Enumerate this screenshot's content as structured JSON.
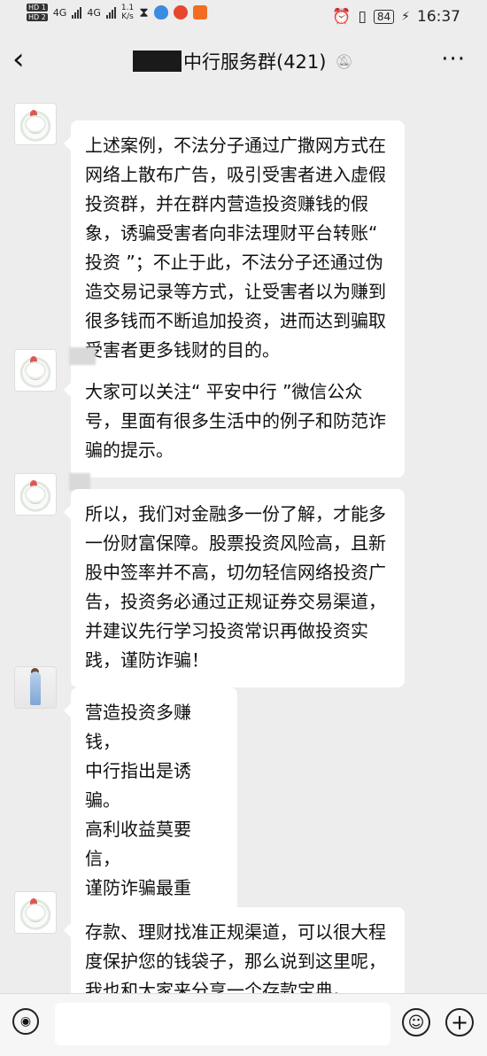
{
  "status_bar": {
    "hd1": "HD 1",
    "hd2": "HD 2",
    "signal1": "4G",
    "signal2": "4G",
    "net_speed_value": "1.1",
    "net_speed_unit": "K/s",
    "battery": "84",
    "time": "16:37"
  },
  "header": {
    "title": "中行服务群(421)",
    "back_icon": "chevron-left-icon",
    "mute_icon": "bell-off-icon",
    "more_icon": "more-dots-icon"
  },
  "messages": [
    {
      "text": "上述案例，不法分子通过广撒网方式在网络上散布广告，吸引受害者进入虚假投资群，并在群内营造投资赚钱的假象，诱骗受害者向非法理财平台转账“ 投资 ”；不止于此，不法分子还通过伪造交易记录等方式，让受害者以为赚到很多钱而不断追加投资，进而达到骗取受害者更多钱财的目的。"
    },
    {
      "text": "大家可以关注“ 平安中行 ”微信公众号，里面有很多生活中的例子和防范诈骗的提示。"
    },
    {
      "text": "所以，我们对金融多一份了解，才能多一份财富保障。股票投资风险高，且新股中签率并不高，切勿轻信网络投资广告，投资务必通过正规证券交易渠道，并建议先行学习投资常识再做投资实践，谨防诈骗！"
    },
    {
      "lines": [
        "营造投资多赚",
        "钱，",
        "中行指出是诱",
        "骗。",
        "高利收益莫要",
        "信，",
        "谨防诈骗最重要。"
      ]
    },
    {
      "text": "存款、理财找准正规渠道，可以很大程度保护您的钱袋子，那么说到这里呢，我也和大家来分享一个存款宝典。"
    }
  ],
  "input_bar": {
    "voice_icon": "voice-icon",
    "emoji_icon": "emoji-icon",
    "plus_icon": "plus-icon",
    "input_value": ""
  }
}
